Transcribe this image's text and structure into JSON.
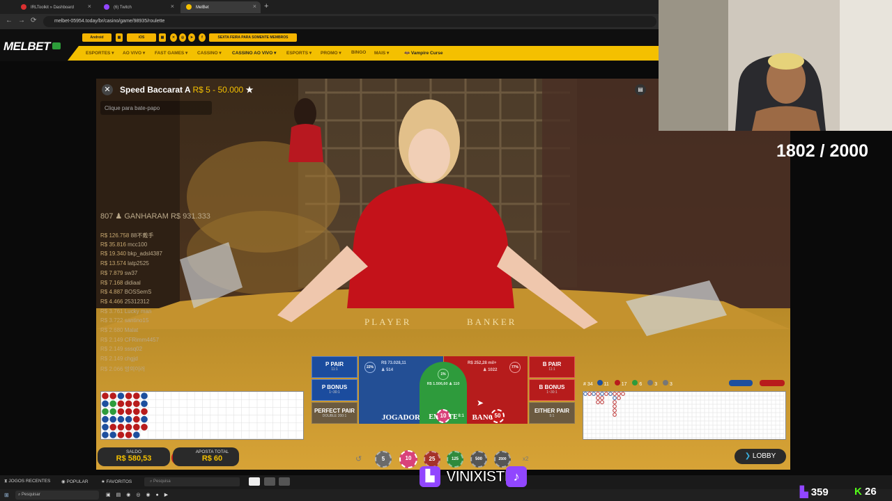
{
  "browser": {
    "tabs": [
      {
        "label": "IRLToolkit » Dashboard",
        "color": "#d93030"
      },
      {
        "label": "(6) Twitch",
        "color": "#9146ff"
      },
      {
        "label": "MelBet",
        "color": "#f4c000"
      }
    ],
    "new_tab": "+",
    "back": "←",
    "forward": "→",
    "reload": "⟳",
    "url": "melbet-05954.today/br/casino/game/98935/roulette"
  },
  "melbet": {
    "logo": "MELBET",
    "top_buttons": [
      "Android",
      "iOS",
      "SEXTA FEIRA PARA SOMENTE MEMBROS"
    ],
    "nav": [
      "ESPORTES ▾",
      "AO VIVO ▾",
      "FAST GAMES ▾",
      "CASSINO ▾",
      "CASSINO AO VIVO ▾",
      "ESPORTS ▾",
      "PROMO ▾",
      "BINGO",
      "MAIS ▾",
      "Vampire Curse"
    ]
  },
  "game": {
    "close": "✕",
    "title": "Speed Baccarat A",
    "limit": "R$ 5 - 50.000",
    "chat_placeholder": "Clique para bate-papo",
    "table_left": "PLAYER",
    "table_right": "BANKER",
    "winners_count": "807",
    "winners_label": "GANHARAM R$ 931.333",
    "winners": [
      {
        "amount": "R$ 126.758",
        "name": "88不戴手"
      },
      {
        "amount": "R$ 35.816",
        "name": "mcc100"
      },
      {
        "amount": "R$ 19.340",
        "name": "bkp_adsl4387"
      },
      {
        "amount": "R$ 13.574",
        "name": "latp2525"
      },
      {
        "amount": "R$ 7.879",
        "name": "sw37"
      },
      {
        "amount": "R$ 7.168",
        "name": "didiaal"
      },
      {
        "amount": "R$ 4.887",
        "name": "BOSSemS"
      },
      {
        "amount": "R$ 4.466",
        "name": "25312312"
      },
      {
        "amount": "R$ 3.761",
        "name": "Lucky man"
      },
      {
        "amount": "R$ 3.722",
        "name": "santino15"
      },
      {
        "amount": "R$ 2.680",
        "name": "Malat"
      },
      {
        "amount": "R$ 2.149",
        "name": "CFRimm4457"
      },
      {
        "amount": "R$ 2.149",
        "name": "sssq02"
      },
      {
        "amount": "R$ 2.149",
        "name": "chgjd"
      },
      {
        "amount": "R$ 2.066",
        "name": "망의이러"
      }
    ],
    "bets": {
      "p_pair": "P PAIR",
      "p_pair_odds": "11:1",
      "p_bonus": "P BONUS",
      "p_bonus_odds": "1~30:1",
      "perfect_pair": "PERFECT PAIR",
      "perfect_pair_odds": "DOUBLE 200:1",
      "jogador": "JOGADOR",
      "jogador_total": "R$ 73.028,11",
      "jogador_players": "514",
      "jogador_pct": "22%",
      "empate": "EMPATE",
      "empate_total": "R$ 1.506,60",
      "empate_players": "110",
      "empate_pct": "1%",
      "empate_odds": "8:1",
      "banca": "BANCA",
      "banca_total": "R$ 252,28 mil+",
      "banca_players": "1022",
      "banca_pct": "77%",
      "b_pair": "B PAIR",
      "b_pair_odds": "11:1",
      "b_bonus": "B BONUS",
      "b_bonus_odds": "1~30:1",
      "either_pair": "EITHER PAIR",
      "either_pair_odds": "5:1",
      "chip_empate": "10",
      "chip_banca": "50"
    },
    "stats": {
      "round": "# 34",
      "p": "11",
      "b": "17",
      "t": "6",
      "pp": "3",
      "bp": "3"
    },
    "balance_label": "SALDO",
    "balance_value": "R$ 580,53",
    "total_bet_label": "APOSTA TOTAL",
    "total_bet_value": "R$ 60",
    "chips": [
      "5",
      "10",
      "25",
      "125",
      "500",
      "2500"
    ],
    "undo": "↺",
    "double": "x2",
    "lobby": "LOBBY"
  },
  "stream": {
    "counter": "1802 / 2000",
    "brand": "VINIXISTE",
    "twitch_count": "359",
    "kick_count": "26"
  },
  "bottom_bar": {
    "recent": "JOGOS RECENTES",
    "popular": "POPULAR",
    "favorites": "FAVORITOS",
    "search": "Pesquisa"
  },
  "taskbar": {
    "search": "Pesquisar"
  },
  "colors": {
    "accent": "#f4c000",
    "player": "#1d4f9e",
    "banker": "#b81c1c",
    "tie": "#2e9b3c"
  }
}
